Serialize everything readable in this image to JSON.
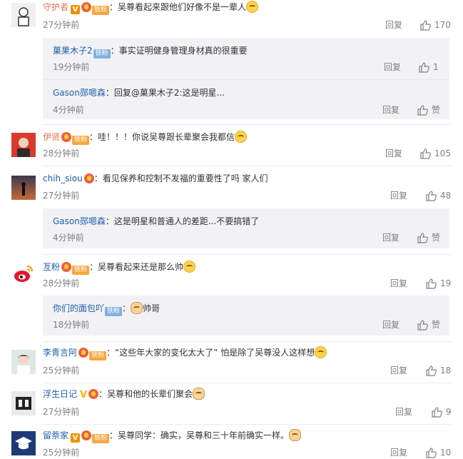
{
  "comments": [
    {
      "user": "守护者",
      "text": "：吴尊看起来跟他们好像不是一辈人",
      "time": "27分钟前",
      "reply": "回复",
      "likes": "170",
      "fan_badge": "铁粉",
      "replies": [
        {
          "user": "菓果木子2",
          "fan_badge": "铁粉",
          "text": "：事实证明健身管理身材真的很重要",
          "time": "19分钟前",
          "reply": "回复",
          "likes": "1"
        },
        {
          "user": "Gason郧嗯森",
          "text": "：回复@菓果木子2:这是明星...",
          "time": "4分钟前",
          "reply": "回复",
          "likes": "赞"
        }
      ]
    },
    {
      "user": "伊贤",
      "text": "：哇！！！你说吴尊跟长辈聚会我都信",
      "time": "28分钟前",
      "reply": "回复",
      "likes": "105",
      "fan_badge": "铁粉"
    },
    {
      "user": "chih_siou",
      "text": "：看见保养和控制不发福的重要性了吗 家人们",
      "time": "27分钟前",
      "reply": "回复",
      "likes": "48",
      "replies": [
        {
          "user": "Gason郧嗯森",
          "text": "：这是明星和普通人的差距...不要搞错了",
          "time": "4分钟前",
          "reply": "回复",
          "likes": "赞"
        }
      ]
    },
    {
      "user": "亙粉",
      "text": "：吴尊看起来还是那么帅",
      "time": "28分钟前",
      "reply": "回复",
      "likes": "19",
      "fan_badge": "铁粉",
      "replies": [
        {
          "user": "你们的面包吖",
          "fan_badge": "铁粉",
          "text": "：",
          "text2": "帅哥",
          "time": "18分钟前",
          "reply": "回复",
          "likes": "赞"
        }
      ]
    },
    {
      "user": "李青言阿",
      "text": "：“这些年大家的变化太大了” 怕是除了吴尊没人这样想",
      "time": "25分钟前",
      "reply": "回复",
      "likes": "18",
      "fan_badge": "铁粉"
    },
    {
      "user": "浮生日记",
      "text": "：吴尊和他的长辈们聚会",
      "time": "27分钟前",
      "reply": "回复",
      "likes": "9"
    },
    {
      "user": "留萘家",
      "text": "：吴尊同学：确实，吴尊和三十年前确实一样。",
      "time": "25分钟前",
      "reply": "回复",
      "likes": "10",
      "fan_badge": "铁粉"
    }
  ]
}
